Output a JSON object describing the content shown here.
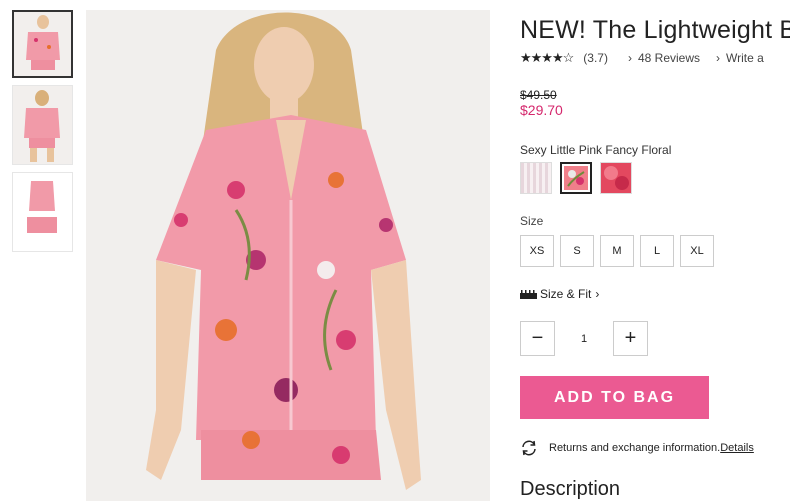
{
  "product": {
    "title": "NEW! The Lightweight B",
    "rating_stars": "★★★★☆",
    "rating_avg": "(3.7)",
    "reviews": "48 Reviews",
    "write_review": "Write a",
    "old_price": "$49.50",
    "new_price": "$29.70",
    "color_name": "Sexy Little Pink Fancy Floral",
    "size_label": "Size",
    "sizes": [
      "XS",
      "S",
      "M",
      "L",
      "XL"
    ],
    "size_fit": "Size & Fit",
    "quantity": "1",
    "minus": "−",
    "plus": "+",
    "add_to_bag": "ADD TO BAG",
    "returns_text": "Returns and exchange information.",
    "returns_link": "Details",
    "description_heading": "Description"
  },
  "colors": {
    "accent": "#eb5a92",
    "sale_price": "#d5286d",
    "swatch_stripe": "#e7d6dc",
    "swatch_floral": "#f07f8a",
    "swatch_rose": "#e3485f"
  }
}
